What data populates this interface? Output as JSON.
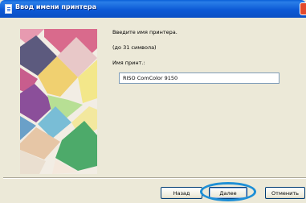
{
  "window": {
    "title": "Ввод имени принтера"
  },
  "form": {
    "prompt": "Введите имя принтера.",
    "limit": "(до 31 символа)",
    "field_label": "Имя принт.:",
    "field_value": "RISO ComColor 9150"
  },
  "buttons": {
    "back": "Назад",
    "next": "Далее",
    "cancel": "Отменить"
  },
  "colors": {
    "titlebar": "#0a5fd8",
    "dialog_bg": "#ece9d8",
    "highlight_ring": "#1e8fd6"
  },
  "icons": {
    "title": "printer-document-icon",
    "close": "close-icon"
  }
}
